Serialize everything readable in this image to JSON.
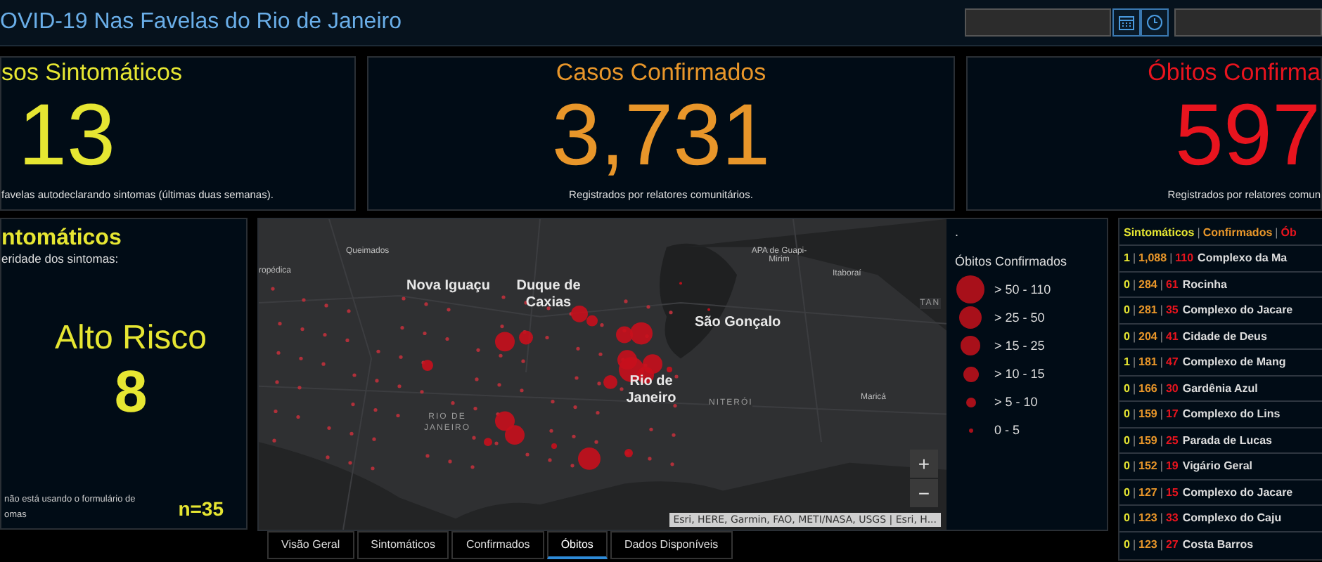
{
  "header": {
    "title": "OVID-19 Nas Favelas do Rio de Janeiro"
  },
  "cards": [
    {
      "title": "sos Sintomáticos",
      "value": "13",
      "caption": "favelas autodeclarando sintomas (últimas duas semanas).",
      "color": "#e6e632"
    },
    {
      "title": "Casos Confirmados",
      "value": "3,731",
      "caption": "Registrados por relatores comunitários.",
      "color": "#e8962a"
    },
    {
      "title": "Óbitos Confirma",
      "value": "597",
      "caption": "Registrados por relatores comun",
      "color": "#e8141e"
    }
  ],
  "symptoms_panel": {
    "title": "ntomáticos",
    "subtitle": "eridade dos sintomas:",
    "category": "Alto Risco",
    "value": "8",
    "note_lines": [
      "não está usando o formulário de",
      "omas"
    ],
    "count": "n=35"
  },
  "map": {
    "labels": [
      {
        "text": "Queimados",
        "kind": "minor"
      },
      {
        "text": "APA de Guapi-Mirim",
        "kind": "minor"
      },
      {
        "text": "ropédica",
        "kind": "minor"
      },
      {
        "text": "Itaboraí",
        "kind": "minor"
      },
      {
        "text": "Nova Iguaçu",
        "kind": "major"
      },
      {
        "text": "Duque de Caxias",
        "kind": "major"
      },
      {
        "text": "TAN",
        "kind": "region"
      },
      {
        "text": "São Gonçalo",
        "kind": "major"
      },
      {
        "text": "Rio de Janeiro",
        "kind": "major"
      },
      {
        "text": "Maricá",
        "kind": "minor"
      },
      {
        "text": "NITERÓI",
        "kind": "region"
      },
      {
        "text": "RIO DE JANEIRO",
        "kind": "region"
      }
    ],
    "zoom_in": "+",
    "zoom_out": "−",
    "attribution": "Esri, HERE, Garmin, FAO, METI/NASA, USGS | Esri, H..."
  },
  "legend": {
    "marker": ".",
    "title": "Óbitos Confirmados",
    "items": [
      "> 50 - 110",
      "> 25 - 50",
      "> 15 - 25",
      "> 10 - 15",
      "> 5 - 10",
      "0 - 5"
    ]
  },
  "tabs": [
    {
      "label": "Visão Geral",
      "selected": false
    },
    {
      "label": "Sintomáticos",
      "selected": false
    },
    {
      "label": "Confirmados",
      "selected": false
    },
    {
      "label": "Óbitos",
      "selected": true
    },
    {
      "label": "Dados Disponíveis",
      "selected": false
    }
  ],
  "ranking": {
    "separator": "|",
    "header": [
      {
        "text": "Sintomáticos",
        "color": "#e6e632"
      },
      {
        "text": "Confirmados",
        "color": "#e8962a"
      },
      {
        "text": "Ób",
        "color": "#e8141e"
      }
    ],
    "rows": [
      {
        "symptomatic": "1",
        "confirmed": "1,088",
        "deaths": "110",
        "name": "Complexo da Ma"
      },
      {
        "symptomatic": "0",
        "confirmed": "284",
        "deaths": "61",
        "name": "Rocinha"
      },
      {
        "symptomatic": "0",
        "confirmed": "281",
        "deaths": "35",
        "name": "Complexo do Jacare"
      },
      {
        "symptomatic": "0",
        "confirmed": "204",
        "deaths": "41",
        "name": "Cidade de Deus"
      },
      {
        "symptomatic": "1",
        "confirmed": "181",
        "deaths": "47",
        "name": "Complexo de Mang"
      },
      {
        "symptomatic": "0",
        "confirmed": "166",
        "deaths": "30",
        "name": "Gardênia Azul"
      },
      {
        "symptomatic": "0",
        "confirmed": "159",
        "deaths": "17",
        "name": "Complexo do Lins"
      },
      {
        "symptomatic": "0",
        "confirmed": "159",
        "deaths": "25",
        "name": "Parada de Lucas"
      },
      {
        "symptomatic": "0",
        "confirmed": "152",
        "deaths": "19",
        "name": "Vigário Geral"
      },
      {
        "symptomatic": "0",
        "confirmed": "127",
        "deaths": "15",
        "name": "Complexo do Jacare"
      },
      {
        "symptomatic": "0",
        "confirmed": "123",
        "deaths": "33",
        "name": "Complexo do Caju"
      },
      {
        "symptomatic": "0",
        "confirmed": "123",
        "deaths": "27",
        "name": "Costa Barros"
      }
    ]
  }
}
